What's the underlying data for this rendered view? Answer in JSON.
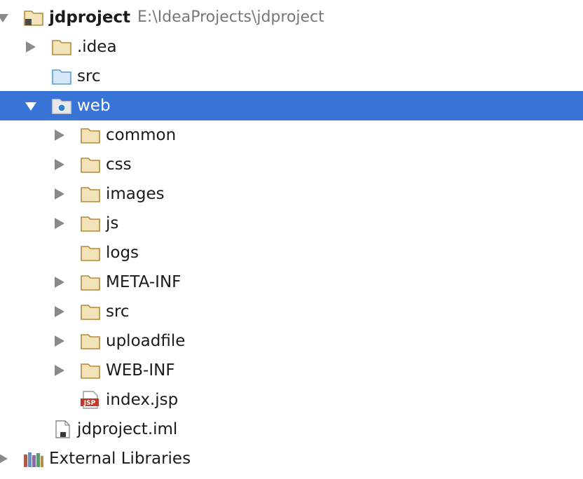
{
  "tree": {
    "root": {
      "label": "jdproject",
      "path": "E:\\IdeaProjects\\jdproject",
      "icon": "project-folder-icon",
      "expanded": true
    },
    "items": [
      {
        "label": ".idea",
        "icon": "folder-icon",
        "expandable": true,
        "expanded": false
      },
      {
        "label": "src",
        "icon": "source-folder-icon",
        "expandable": false
      },
      {
        "label": "web",
        "icon": "web-folder-icon",
        "expandable": true,
        "expanded": true,
        "selected": true
      },
      {
        "label": "common",
        "icon": "folder-icon",
        "expandable": true,
        "expanded": false
      },
      {
        "label": "css",
        "icon": "folder-icon",
        "expandable": true,
        "expanded": false
      },
      {
        "label": "images",
        "icon": "folder-icon",
        "expandable": true,
        "expanded": false
      },
      {
        "label": "js",
        "icon": "folder-icon",
        "expandable": true,
        "expanded": false
      },
      {
        "label": "logs",
        "icon": "folder-icon",
        "expandable": false
      },
      {
        "label": "META-INF",
        "icon": "folder-icon",
        "expandable": true,
        "expanded": false
      },
      {
        "label": "src",
        "icon": "folder-icon",
        "expandable": true,
        "expanded": false
      },
      {
        "label": "uploadfile",
        "icon": "folder-icon",
        "expandable": true,
        "expanded": false
      },
      {
        "label": "WEB-INF",
        "icon": "folder-icon",
        "expandable": true,
        "expanded": false
      },
      {
        "label": "index.jsp",
        "icon": "jsp-file-icon",
        "icon_text": "JSP",
        "expandable": false
      },
      {
        "label": "jdproject.iml",
        "icon": "iml-file-icon",
        "expandable": false
      },
      {
        "label": "External Libraries",
        "icon": "libraries-icon",
        "expandable": true,
        "expanded": false
      }
    ]
  },
  "colors": {
    "selection": "#3875d7",
    "folder": "#c9a04a",
    "source_folder": "#5a9bd4",
    "arrow": "#8a8a8a",
    "path_text": "#777777"
  }
}
